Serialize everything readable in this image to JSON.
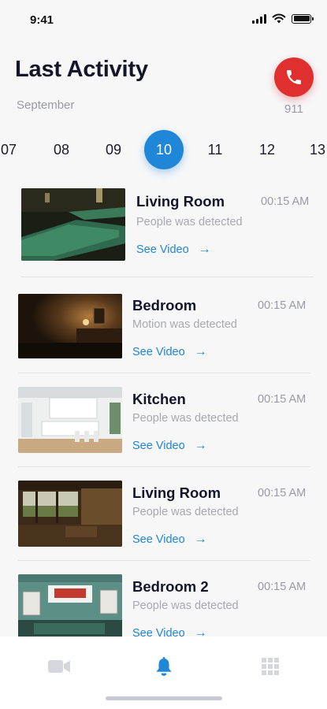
{
  "status_bar": {
    "time": "9:41"
  },
  "header": {
    "title": "Last Activity",
    "month": "September"
  },
  "emergency": {
    "label": "911",
    "icon": "phone-icon",
    "color": "#e02f2f"
  },
  "dates": [
    {
      "day": "07",
      "active": false
    },
    {
      "day": "08",
      "active": false
    },
    {
      "day": "09",
      "active": false
    },
    {
      "day": "10",
      "active": true
    },
    {
      "day": "11",
      "active": false
    },
    {
      "day": "12",
      "active": false
    },
    {
      "day": "13",
      "active": false
    }
  ],
  "activities": [
    {
      "room": "Living Room",
      "time": "00:15 AM",
      "event": "People was detected",
      "action": "See Video",
      "arrow": "→"
    },
    {
      "room": "Bedroom",
      "time": "00:15 AM",
      "event": "Motion was detected",
      "action": "See Video",
      "arrow": "→"
    },
    {
      "room": "Kitchen",
      "time": "00:15 AM",
      "event": "People was detected",
      "action": "See Video",
      "arrow": "→"
    },
    {
      "room": "Living Room",
      "time": "00:15 AM",
      "event": "People was detected",
      "action": "See Video",
      "arrow": "→"
    },
    {
      "room": "Bedroom 2",
      "time": "00:15 AM",
      "event": "People was detected",
      "action": "See Video",
      "arrow": "→"
    }
  ],
  "tab_bar": {
    "tabs": [
      {
        "name": "video-camera-icon",
        "active": false
      },
      {
        "name": "bell-icon",
        "active": true
      },
      {
        "name": "grid-icon",
        "active": false
      }
    ],
    "active_color": "#1f86d8",
    "inactive_color": "#d6d7de"
  },
  "colors": {
    "accent": "#1f86d8",
    "alert": "#e02f2f"
  }
}
